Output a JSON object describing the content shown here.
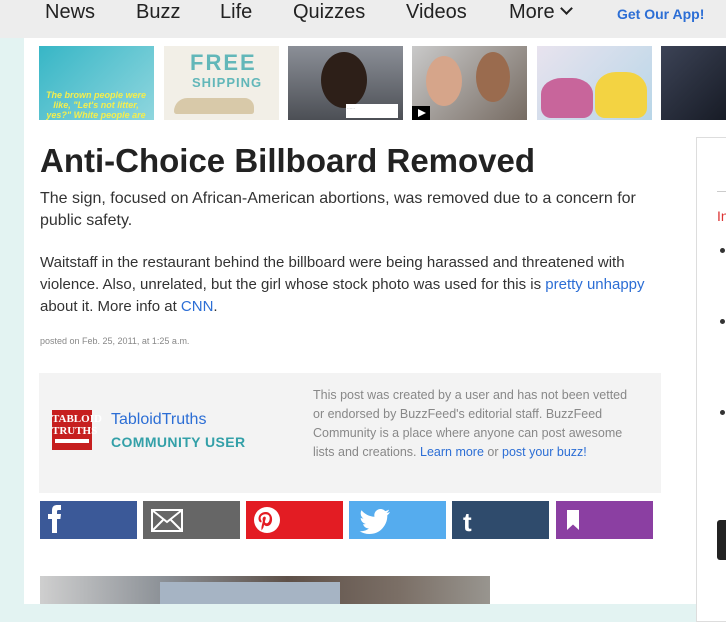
{
  "nav": {
    "items": [
      "News",
      "Buzz",
      "Life",
      "Quizzes",
      "Videos",
      "More"
    ],
    "app_link": "Get Our App!"
  },
  "thumbnails": [
    {
      "caption": "The brown people were like, \"Let's not litter, yes?\" White people are there."
    },
    {
      "line1": "FREE",
      "line2": "SHIPPING"
    },
    {
      "tweet": "……"
    },
    {},
    {},
    {}
  ],
  "article": {
    "title": "Anti-Choice Billboard Removed",
    "dek": "The sign, focused on African-American abortions, was removed due to a concern for public safety.",
    "body_part1": "Waitstaff in the restaurant behind the billboard were being harassed and threatened with violence. Also, unrelated, but the girl whose stock photo was used for this is ",
    "body_link1": "pretty unhappy",
    "body_part2": " about it. More info at ",
    "body_link2": "CNN",
    "body_part3": ".",
    "posted": "posted on Feb. 25, 2011, at 1:25 a.m."
  },
  "author": {
    "logo_line1": "TABLOID",
    "logo_line2": "TRUTHS",
    "name": "TabloidTruths",
    "role": "COMMUNITY USER",
    "note": "This post was created by a user and has not been vetted or endorsed by BuzzFeed's editorial staff. BuzzFeed Community is a place where anyone can post awesome lists and creations. ",
    "learn_more": "Learn more",
    "or": " or ",
    "post_link": "post your buzz!"
  },
  "share": [
    {
      "network": "facebook",
      "icon": "facebook-icon",
      "color": "#3b5998"
    },
    {
      "network": "email",
      "icon": "envelope-icon",
      "color": "#666666"
    },
    {
      "network": "pinterest",
      "icon": "pinterest-icon",
      "color": "#e31c23"
    },
    {
      "network": "twitter",
      "icon": "twitter-bird-icon",
      "color": "#55acee"
    },
    {
      "network": "tumblr",
      "icon": "tumblr-icon",
      "color": "#2f4b6c"
    },
    {
      "network": "bookmark",
      "icon": "bookmark-icon",
      "color": "#8b3fa2"
    }
  ],
  "sidebar": {
    "label": "In"
  },
  "colors": {
    "link": "#2c6ed5",
    "community": "#33a0a8",
    "page_bg": "#e3f3f2"
  }
}
